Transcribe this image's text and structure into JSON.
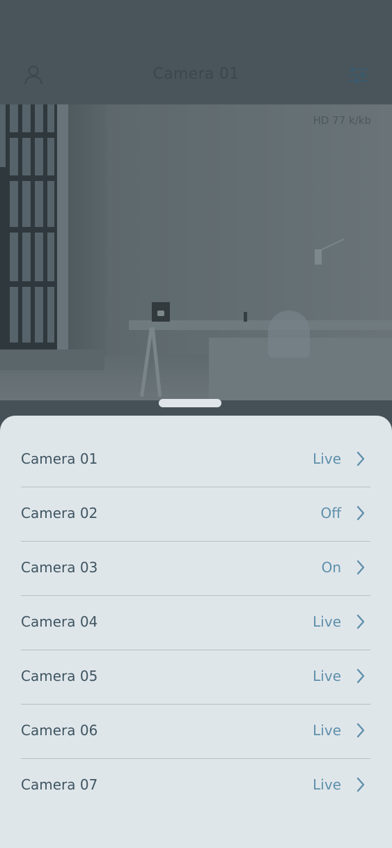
{
  "header": {
    "title": "Camera 01",
    "profile_icon": "user-icon",
    "filter_icon": "sliders-icon"
  },
  "video": {
    "overlay": "HD  77 k/kb"
  },
  "cameras": [
    {
      "name": "Camera 01",
      "status": "Live"
    },
    {
      "name": "Camera 02",
      "status": "Off"
    },
    {
      "name": "Camera 03",
      "status": "On"
    },
    {
      "name": "Camera 04",
      "status": "Live"
    },
    {
      "name": "Camera 05",
      "status": "Live"
    },
    {
      "name": "Camera 06",
      "status": "Live"
    },
    {
      "name": "Camera 07",
      "status": "Live"
    }
  ],
  "colors": {
    "accent": "#5f90ab",
    "text": "#3f5561",
    "sheet": "#dfe6ea",
    "divider": "#b7c0c5"
  }
}
